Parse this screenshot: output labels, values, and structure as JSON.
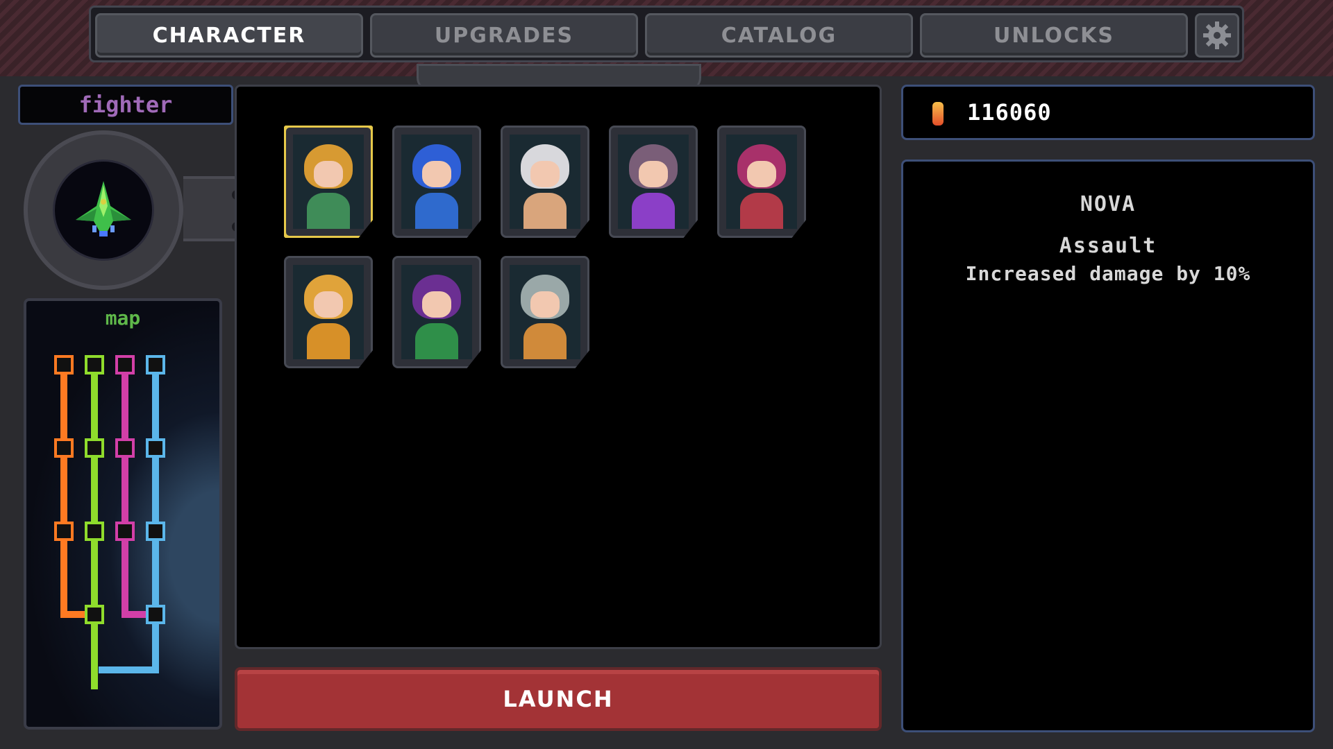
{
  "tabs": [
    {
      "label": "CHARACTER",
      "active": true
    },
    {
      "label": "UPGRADES",
      "active": false
    },
    {
      "label": "CATALOG",
      "active": false
    },
    {
      "label": "UNLOCKS",
      "active": false
    }
  ],
  "settings_icon": "gear-icon",
  "ship": {
    "class_label": "fighter",
    "icon": "ship-icon"
  },
  "map": {
    "label": "map",
    "path_colors": [
      "#ff7a22",
      "#8fdc2c",
      "#d23fa8",
      "#5bb6ea"
    ]
  },
  "characters": [
    {
      "id": "nova",
      "hair": "#d79a32",
      "body": "#3f8c58",
      "selected": true
    },
    {
      "id": "char2",
      "hair": "#2e5fd6",
      "body": "#2f6acd",
      "selected": false
    },
    {
      "id": "char3",
      "hair": "#d8d8dc",
      "body": "#d9a57c",
      "selected": false
    },
    {
      "id": "char4",
      "hair": "#7a5e78",
      "body": "#8b3fc7",
      "selected": false
    },
    {
      "id": "char5",
      "hair": "#a8316a",
      "body": "#b23a48",
      "selected": false
    },
    {
      "id": "char6",
      "hair": "#e0a33a",
      "body": "#d79028",
      "selected": false
    },
    {
      "id": "char7",
      "hair": "#6b2f92",
      "body": "#2f8f49",
      "selected": false
    },
    {
      "id": "char8",
      "hair": "#9aa8a8",
      "body": "#d08a3a",
      "selected": false
    }
  ],
  "launch_label": "LAUNCH",
  "currency": {
    "value": "116060",
    "icon": "crystal-icon"
  },
  "info": {
    "name": "NOVA",
    "role": "Assault",
    "description": "Increased damage by 10%"
  }
}
